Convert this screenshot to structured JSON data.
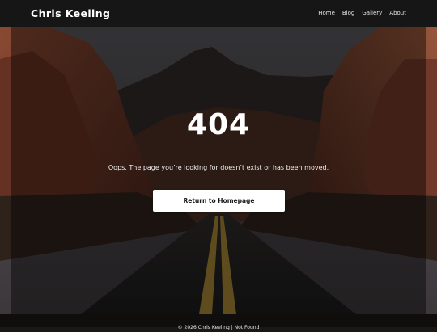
{
  "header": {
    "brand": "Chris Keeling",
    "nav": [
      {
        "label": "Home"
      },
      {
        "label": "Blog"
      },
      {
        "label": "Gallery"
      },
      {
        "label": "About"
      }
    ]
  },
  "error": {
    "code": "404",
    "message": "Oops. The page you’re looking for doesn’t exist or has been moved.",
    "button_label": "Return to Homepage"
  },
  "footer": {
    "text": "© 2026 Chris Keeling | Not Found"
  },
  "colors": {
    "header_bg": "#161616",
    "overlay": "#000000",
    "button_bg": "#ffffff",
    "button_text": "#1a1a1a",
    "rock": "#8a4a35"
  }
}
